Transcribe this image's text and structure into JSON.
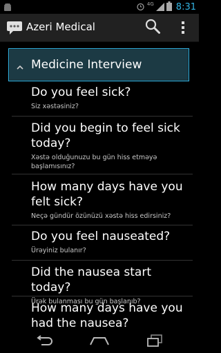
{
  "status_bar": {
    "time": "8:31",
    "network_label": "4G",
    "icons": [
      "android-icon",
      "alarm-icon",
      "signal-icon",
      "battery-icon"
    ]
  },
  "action_bar": {
    "title": "Azeri Medical",
    "app_icon": "speech-bubble-icon",
    "actions": [
      "search-icon",
      "overflow-menu-icon"
    ]
  },
  "section": {
    "title": "Medicine Interview",
    "icon": "chevron-up-icon",
    "accent_color": "#33b5e5"
  },
  "items": [
    {
      "en": "Do you feel sick?",
      "az": "Siz xəstəsiniz?"
    },
    {
      "en": "Did you begin to feel sick today?",
      "az": "Xəstə olduğunuzu bu gün hiss etməyə başlamısınız?"
    },
    {
      "en": "How many days have you felt sick?",
      "az": "Neçə gündür özünüzü xəstə hiss edirsiniz?"
    },
    {
      "en": "Do you feel nauseated?",
      "az": "Ürəyiniz bulanır?"
    },
    {
      "en": "Did the nausea start today?",
      "az": "Ürək bulanması bu gün başlanıb?"
    },
    {
      "en": "How many days have you had the nausea?",
      "az": ""
    }
  ],
  "nav_bar": {
    "buttons": [
      "back-icon",
      "home-icon",
      "recent-apps-icon"
    ]
  }
}
